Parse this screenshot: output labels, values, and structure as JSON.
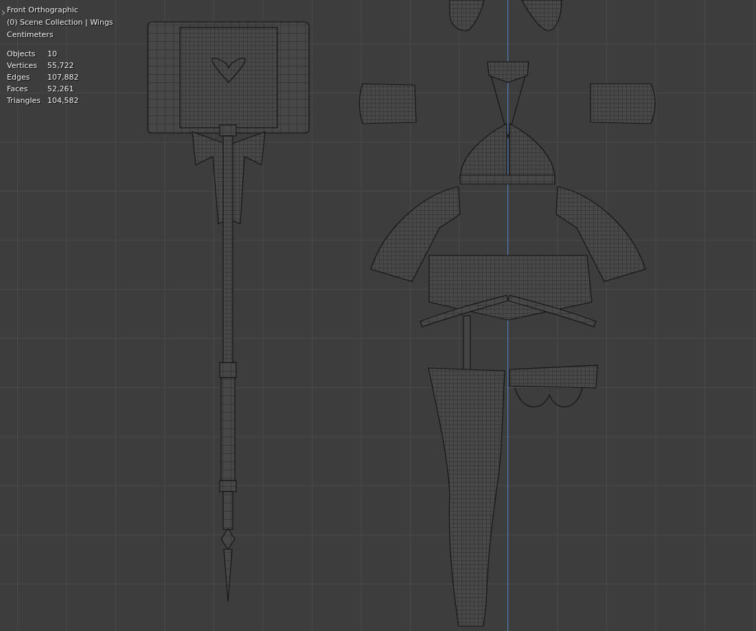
{
  "viewport": {
    "view_name": "Front Orthographic",
    "collection": "(0) Scene Collection | Wings",
    "units": "Centimeters"
  },
  "statistics": [
    {
      "label": "Objects",
      "value": "10"
    },
    {
      "label": "Vertices",
      "value": "55,722"
    },
    {
      "label": "Edges",
      "value": "107,882"
    },
    {
      "label": "Faces",
      "value": "52,261"
    },
    {
      "label": "Triangles",
      "value": "104,582"
    }
  ]
}
